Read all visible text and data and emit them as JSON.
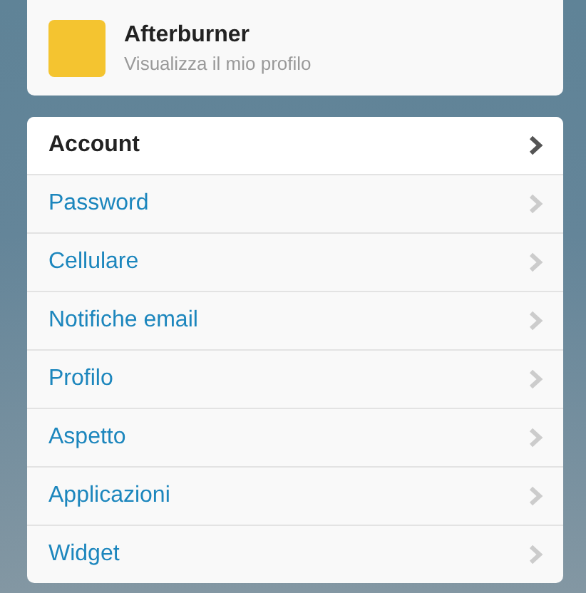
{
  "profile": {
    "name": "Afterburner",
    "link": "Visualizza il mio profilo"
  },
  "menu": [
    {
      "label": "Account",
      "selected": true
    },
    {
      "label": "Password",
      "selected": false
    },
    {
      "label": "Cellulare",
      "selected": false
    },
    {
      "label": "Notifiche email",
      "selected": false
    },
    {
      "label": "Profilo",
      "selected": false
    },
    {
      "label": "Aspetto",
      "selected": false
    },
    {
      "label": "Applicazioni",
      "selected": false
    },
    {
      "label": "Widget",
      "selected": false
    }
  ]
}
